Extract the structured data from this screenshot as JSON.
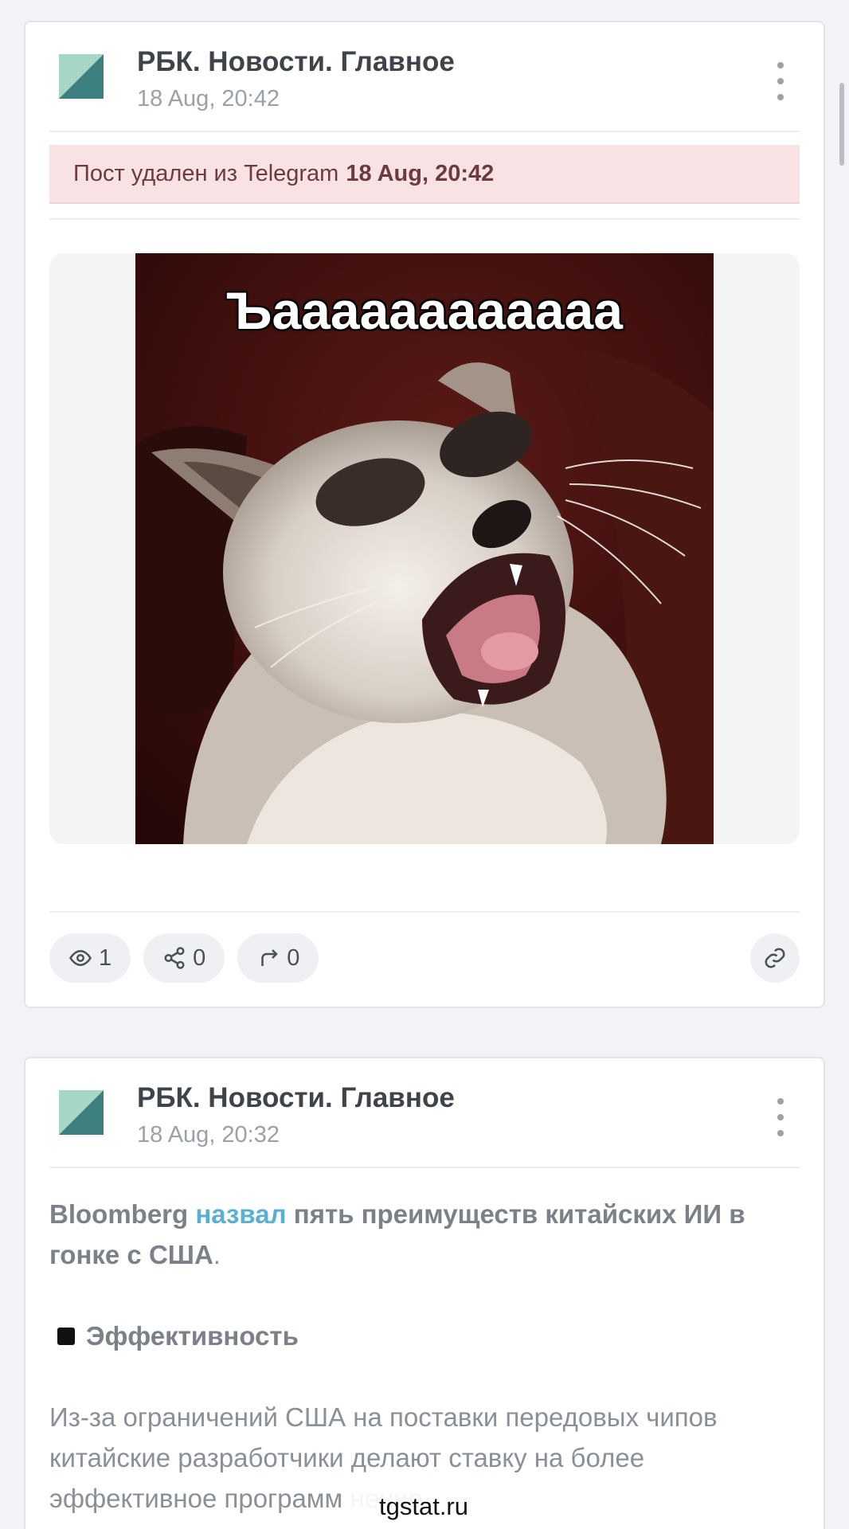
{
  "posts": [
    {
      "channel": "РБК. Новости. Главное",
      "time": "18 Aug, 20:42",
      "deleted_notice": {
        "text": "Пост удален из Telegram",
        "time": "18 Aug, 20:42"
      },
      "media": {
        "caption": "Ъаааааааааааа",
        "icon": "cat-meme-image"
      },
      "stats": {
        "views": "1",
        "shares": "0",
        "forwards": "0"
      }
    },
    {
      "channel": "РБК. Новости. Главное",
      "time": "18 Aug, 20:32",
      "text": {
        "lead_before": "Bloomberg ",
        "lead_link": "назвал",
        "lead_after": " пять преимуществ китайских ИИ в гонке с США",
        "lead_end": ".",
        "section_title": "Эффективность",
        "body": "Из-за ограничений США на поставки передовых чипов китайские разработчики делают ставку на более эффективное программ          нение."
      }
    }
  ],
  "watermark": "tgstat.ru",
  "colors": {
    "accent_link": "#5ab0d0",
    "deleted_bg": "#f9e2e4",
    "logo_teal": "#3e8080",
    "logo_mint": "#a6d6c4"
  }
}
